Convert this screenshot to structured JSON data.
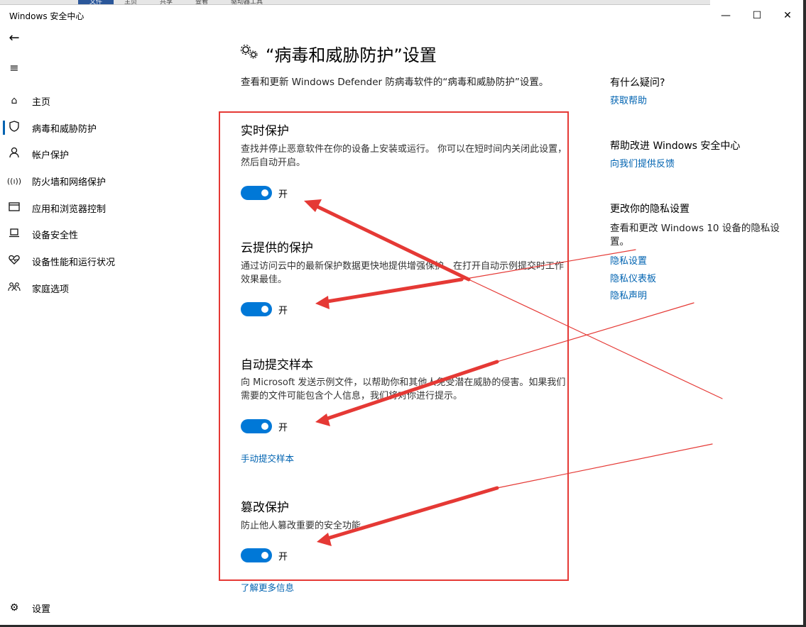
{
  "window": {
    "title": "Windows 安全中心",
    "top_tabs": [
      "文件",
      "主页",
      "共享",
      "查看",
      "驱动器工具"
    ],
    "min": "—",
    "max": "☐",
    "close": "✕"
  },
  "sidebar": {
    "items": [
      {
        "label": "主页"
      },
      {
        "label": "病毒和威胁防护"
      },
      {
        "label": "帐户保护"
      },
      {
        "label": "防火墙和网络保护"
      },
      {
        "label": "应用和浏览器控制"
      },
      {
        "label": "设备安全性"
      },
      {
        "label": "设备性能和运行状况"
      },
      {
        "label": "家庭选项"
      }
    ],
    "settings_label": "设置"
  },
  "main": {
    "title": "“病毒和威胁防护”设置",
    "subtitle": "查看和更新 Windows Defender 防病毒软件的“病毒和威胁防护”设置。",
    "sections": [
      {
        "title": "实时保护",
        "desc": "查找并停止恶意软件在你的设备上安装或运行。 你可以在短时间内关闭此设置，然后自动开启。",
        "toggle_label": "开"
      },
      {
        "title": "云提供的保护",
        "desc": "通过访问云中的最新保护数据更快地提供增强保护。在打开自动示例提交时工作效果最佳。",
        "toggle_label": "开"
      },
      {
        "title": "自动提交样本",
        "desc": "向 Microsoft 发送示例文件，以帮助你和其他人免受潜在威胁的侵害。如果我们需要的文件可能包含个人信息，我们将对你进行提示。",
        "toggle_label": "开",
        "link": "手动提交样本"
      },
      {
        "title": "篡改保护",
        "desc": "防止他人篡改重要的安全功能。",
        "toggle_label": "开"
      }
    ],
    "more_info": "了解更多信息"
  },
  "right": {
    "q_head": "有什么疑问?",
    "q_link": "获取帮助",
    "improve_head": "帮助改进 Windows 安全中心",
    "improve_link": "向我们提供反馈",
    "privacy_head": "更改你的隐私设置",
    "privacy_text": "查看和更改 Windows 10 设备的隐私设置。",
    "privacy_links": [
      "隐私设置",
      "隐私仪表板",
      "隐私声明"
    ]
  },
  "colors": {
    "accent": "#0078d7",
    "link": "#0063b1",
    "annotation": "#e53935"
  }
}
